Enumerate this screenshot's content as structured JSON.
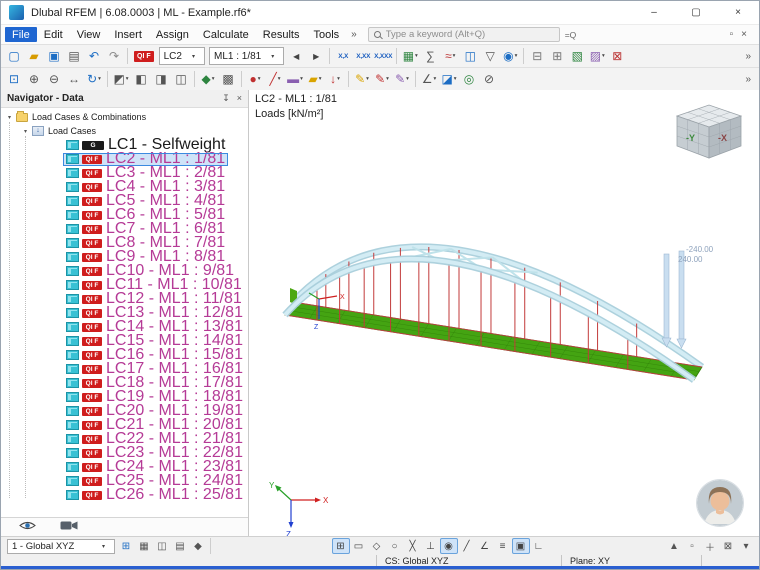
{
  "ui": {
    "caret": "▾",
    "overflow": "»"
  },
  "window": {
    "title": "Dlubal RFEM | 6.08.0003 | ML - Example.rf6*",
    "minimize": "–",
    "maximize": "▢",
    "close": "×"
  },
  "menu": {
    "items": [
      {
        "label": "File",
        "active": true
      },
      {
        "label": "Edit"
      },
      {
        "label": "View"
      },
      {
        "label": "Insert"
      },
      {
        "label": "Assign"
      },
      {
        "label": "Calculate"
      },
      {
        "label": "Results"
      },
      {
        "label": "Tools"
      }
    ],
    "overflow": "»",
    "search_placeholder": "Type a keyword (Alt+Q)",
    "search_options": "=Q",
    "right_icons": [
      {
        "name": "float-panel-icon",
        "glyph": "▫"
      },
      {
        "name": "close-panel-icon",
        "glyph": "×"
      }
    ]
  },
  "toolbar1": {
    "left_icons": [
      {
        "name": "new-model-icon",
        "glyph": "▢",
        "color": "#1c6dc4"
      },
      {
        "name": "open-model-icon",
        "glyph": "▰",
        "color": "#d79b00"
      },
      {
        "name": "save-model-icon",
        "glyph": "▣",
        "color": "#1c6dc4"
      },
      {
        "name": "print-icon",
        "glyph": "▤",
        "color": "#555555"
      },
      {
        "name": "undo-icon",
        "glyph": "↶",
        "color": "#1c6dc4"
      },
      {
        "name": "redo-icon",
        "glyph": "↷",
        "color": "#8a8a8a"
      },
      {
        "sep": true
      }
    ],
    "lc_badge": "QI F",
    "lc_combo": "LC2",
    "ml_combo": "ML1 : 1/81",
    "prev_glyph": "◀",
    "next_glyph": "▶",
    "right_icons": [
      {
        "sep": true
      },
      {
        "name": "decimals-1-icon",
        "text": "X,X"
      },
      {
        "name": "decimals-2-icon",
        "text": "X,XX"
      },
      {
        "name": "decimals-3-icon",
        "text": "X,XXX"
      },
      {
        "sep": true
      },
      {
        "name": "tables-icon",
        "glyph": "▦",
        "color": "#2e8540",
        "dd": true
      },
      {
        "name": "calculation-icon",
        "glyph": "∑",
        "color": "#555555"
      },
      {
        "name": "results-icon",
        "glyph": "≈",
        "color": "#bb3333",
        "dd": true
      },
      {
        "name": "load-table-icon",
        "glyph": "◫",
        "color": "#1c6dc4"
      },
      {
        "name": "filter-icon",
        "glyph": "▽",
        "color": "#555555"
      },
      {
        "name": "visibility-icon",
        "glyph": "◉",
        "color": "#1c6dc4",
        "dd": true
      },
      {
        "sep": true
      },
      {
        "name": "sections-icon",
        "glyph": "⊟",
        "color": "#777777"
      },
      {
        "name": "grid-view-icon",
        "glyph": "⊞",
        "color": "#777777"
      },
      {
        "name": "display-options-icon",
        "glyph": "▧",
        "color": "#2e8540"
      },
      {
        "name": "notes-icon",
        "glyph": "▨",
        "color": "#8a5fb0",
        "dd": true
      },
      {
        "name": "panels-icon",
        "glyph": "⊠",
        "color": "#bb3333"
      }
    ],
    "overflow": "»"
  },
  "toolbar2": {
    "icons": [
      {
        "name": "zoom-window-icon",
        "glyph": "⊡",
        "color": "#1c6dc4"
      },
      {
        "name": "zoom-in-icon",
        "glyph": "⊕",
        "color": "#555555"
      },
      {
        "name": "zoom-out-icon",
        "glyph": "⊖",
        "color": "#555555"
      },
      {
        "name": "pan-view-icon",
        "glyph": "↔",
        "color": "#555555"
      },
      {
        "name": "rotate-view-icon",
        "glyph": "↻",
        "color": "#1c6dc4",
        "dd": true
      },
      {
        "sep": true
      },
      {
        "name": "isometric-view-icon",
        "glyph": "◩",
        "color": "#555555",
        "dd": true
      },
      {
        "name": "view-x-icon",
        "glyph": "◧",
        "color": "#555555"
      },
      {
        "name": "view-y-icon",
        "glyph": "◨",
        "color": "#555555"
      },
      {
        "name": "view-z-icon",
        "glyph": "◫",
        "color": "#555555"
      },
      {
        "sep": true
      },
      {
        "name": "render-mode-icon",
        "glyph": "◆",
        "color": "#2e8540",
        "dd": true
      },
      {
        "name": "display-properties-icon",
        "glyph": "▩",
        "color": "#555555"
      },
      {
        "sep": true
      },
      {
        "name": "new-node-icon",
        "glyph": "●",
        "color": "#c03030",
        "dd": true
      },
      {
        "name": "new-line-icon",
        "glyph": "╱",
        "color": "#c03030",
        "dd": true
      },
      {
        "name": "new-member-icon",
        "glyph": "▬",
        "color": "#8a5fb0",
        "dd": true
      },
      {
        "name": "new-surface-icon",
        "glyph": "▰",
        "color": "#d9a400",
        "dd": true
      },
      {
        "name": "new-load-icon",
        "glyph": "↓",
        "color": "#c03030",
        "dd": true
      },
      {
        "sep": true
      },
      {
        "name": "edit-yellow-pencil-icon",
        "glyph": "✎",
        "color": "#d9a400",
        "dd": true
      },
      {
        "name": "edit-red-pencil-icon",
        "glyph": "✎",
        "color": "#c03030",
        "dd": true
      },
      {
        "name": "edit-purple-pencil-icon",
        "glyph": "✎",
        "color": "#8a5fb0",
        "dd": true
      },
      {
        "sep": true
      },
      {
        "name": "measure-icon",
        "glyph": "∠",
        "color": "#555555",
        "dd": true
      },
      {
        "name": "section-icon",
        "glyph": "◪",
        "color": "#1c6dc4",
        "dd": true
      },
      {
        "name": "visibility-mode-icon",
        "glyph": "◎",
        "color": "#2e8540"
      },
      {
        "name": "clipping-icon",
        "glyph": "⊘",
        "color": "#555555"
      }
    ],
    "overflow": "»"
  },
  "navigator": {
    "title": "Navigator - Data",
    "dock_glyph": "↧",
    "close_glyph": "×",
    "tree": {
      "root": "Load Cases & Combinations",
      "group": "Load Cases",
      "items": [
        {
          "label": "LC1 - Selfweight",
          "badge": "G",
          "kind": "g"
        },
        {
          "label": "LC2 - ML1 : 1/81",
          "badge": "QI F",
          "kind": "qif",
          "selected": true
        },
        {
          "label": "LC3 - ML1 : 2/81",
          "badge": "QI F",
          "kind": "qif"
        },
        {
          "label": "LC4 - ML1 : 3/81",
          "badge": "QI F",
          "kind": "qif"
        },
        {
          "label": "LC5 - ML1 : 4/81",
          "badge": "QI F",
          "kind": "qif"
        },
        {
          "label": "LC6 - ML1 : 5/81",
          "badge": "QI F",
          "kind": "qif"
        },
        {
          "label": "LC7 - ML1 : 6/81",
          "badge": "QI F",
          "kind": "qif"
        },
        {
          "label": "LC8 - ML1 : 7/81",
          "badge": "QI F",
          "kind": "qif"
        },
        {
          "label": "LC9 - ML1 : 8/81",
          "badge": "QI F",
          "kind": "qif"
        },
        {
          "label": "LC10 - ML1 : 9/81",
          "badge": "QI F",
          "kind": "qif"
        },
        {
          "label": "LC11 - ML1 : 10/81",
          "badge": "QI F",
          "kind": "qif"
        },
        {
          "label": "LC12 - ML1 : 11/81",
          "badge": "QI F",
          "kind": "qif"
        },
        {
          "label": "LC13 - ML1 : 12/81",
          "badge": "QI F",
          "kind": "qif"
        },
        {
          "label": "LC14 - ML1 : 13/81",
          "badge": "QI F",
          "kind": "qif"
        },
        {
          "label": "LC15 - ML1 : 14/81",
          "badge": "QI F",
          "kind": "qif"
        },
        {
          "label": "LC16 - ML1 : 15/81",
          "badge": "QI F",
          "kind": "qif"
        },
        {
          "label": "LC17 - ML1 : 16/81",
          "badge": "QI F",
          "kind": "qif"
        },
        {
          "label": "LC18 - ML1 : 17/81",
          "badge": "QI F",
          "kind": "qif"
        },
        {
          "label": "LC19 - ML1 : 18/81",
          "badge": "QI F",
          "kind": "qif"
        },
        {
          "label": "LC20 - ML1 : 19/81",
          "badge": "QI F",
          "kind": "qif"
        },
        {
          "label": "LC21 - ML1 : 20/81",
          "badge": "QI F",
          "kind": "qif"
        },
        {
          "label": "LC22 - ML1 : 21/81",
          "badge": "QI F",
          "kind": "qif"
        },
        {
          "label": "LC23 - ML1 : 22/81",
          "badge": "QI F",
          "kind": "qif"
        },
        {
          "label": "LC24 - ML1 : 23/81",
          "badge": "QI F",
          "kind": "qif"
        },
        {
          "label": "LC25 - ML1 : 24/81",
          "badge": "QI F",
          "kind": "qif"
        },
        {
          "label": "LC26 - ML1 : 25/81",
          "badge": "QI F",
          "kind": "qif"
        }
      ]
    }
  },
  "viewport": {
    "case_label": "LC2 - ML1 : 1/81",
    "loads_label": "Loads [kN/m²]",
    "dim_upper": "-240.00",
    "dim_lower": "240.00",
    "cube": {
      "left_face": "-Y",
      "right_face": "-X"
    },
    "axes": {
      "x": "X",
      "y": "Y",
      "z": "Z"
    },
    "colors": {
      "hanger": "#c23a3a",
      "brace": "#bfe2ea",
      "deck_grid": "#2f7d08"
    }
  },
  "bottombar": {
    "combo": "1 - Global XYZ",
    "left_icons": [
      {
        "name": "work-plane-icon",
        "glyph": "⊞",
        "color": "#1c6dc4"
      },
      {
        "name": "grid-settings-icon",
        "glyph": "▦",
        "color": "#555555"
      },
      {
        "name": "plane-xy-icon",
        "glyph": "◫",
        "color": "#555555"
      },
      {
        "name": "plane-yz-icon",
        "glyph": "▤",
        "color": "#555555"
      },
      {
        "name": "origin-icon",
        "glyph": "◆",
        "color": "#555555"
      },
      {
        "sep": true
      }
    ],
    "center_icons": [
      {
        "name": "snap-grid-icon",
        "glyph": "⊞",
        "active": true
      },
      {
        "name": "snap-endpoint-icon",
        "glyph": "▭"
      },
      {
        "name": "snap-midpoint-icon",
        "glyph": "◇"
      },
      {
        "name": "snap-center-icon",
        "glyph": "○"
      },
      {
        "name": "snap-intersection-icon",
        "glyph": "╳"
      },
      {
        "name": "snap-perpendicular-icon",
        "glyph": "⊥"
      },
      {
        "name": "snap-tangent-icon",
        "glyph": "◉",
        "active": true
      },
      {
        "name": "snap-nearest-icon",
        "glyph": "╱"
      },
      {
        "name": "snap-angle-icon",
        "glyph": "∠"
      },
      {
        "name": "guidelines-icon",
        "glyph": "≡"
      },
      {
        "name": "object-snap-icon",
        "glyph": "▣",
        "active": true
      },
      {
        "name": "ortho-mode-icon",
        "glyph": "∟"
      }
    ],
    "right_icons": [
      {
        "name": "select-mode-icon",
        "glyph": "▲",
        "color": "#555555"
      },
      {
        "name": "box-select-icon",
        "glyph": "▫",
        "color": "#555555"
      },
      {
        "name": "move-mode-icon",
        "glyph": "＋",
        "color": "#555555"
      },
      {
        "name": "lock-view-icon",
        "glyph": "⊠",
        "color": "#555555"
      },
      {
        "name": "more-options-icon",
        "glyph": "▾",
        "color": "#555555"
      }
    ]
  },
  "statusbar": {
    "cs": "CS: Global XYZ",
    "plane": "Plane: XY"
  }
}
